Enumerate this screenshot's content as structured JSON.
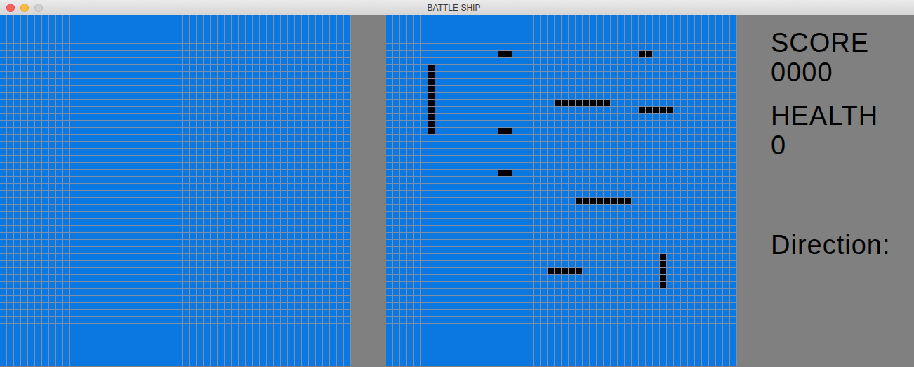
{
  "window": {
    "title": "BATTLE SHIP"
  },
  "player_board": {
    "rows": 50,
    "cols": 50,
    "ships": []
  },
  "enemy_board": {
    "rows": 50,
    "cols": 50,
    "ships": [
      {
        "row": 7,
        "col": 6,
        "length": 10,
        "orientation": "vertical"
      },
      {
        "row": 5,
        "col": 16,
        "length": 2,
        "orientation": "horizontal"
      },
      {
        "row": 5,
        "col": 36,
        "length": 2,
        "orientation": "horizontal"
      },
      {
        "row": 12,
        "col": 24,
        "length": 8,
        "orientation": "horizontal"
      },
      {
        "row": 13,
        "col": 36,
        "length": 5,
        "orientation": "horizontal"
      },
      {
        "row": 16,
        "col": 16,
        "length": 2,
        "orientation": "horizontal"
      },
      {
        "row": 22,
        "col": 16,
        "length": 2,
        "orientation": "horizontal"
      },
      {
        "row": 26,
        "col": 27,
        "length": 8,
        "orientation": "horizontal"
      },
      {
        "row": 36,
        "col": 23,
        "length": 5,
        "orientation": "horizontal"
      },
      {
        "row": 34,
        "col": 39,
        "length": 5,
        "orientation": "vertical"
      }
    ]
  },
  "panel": {
    "score_label": "SCORE",
    "score": "0000",
    "health_label": "HEALTH",
    "health": "0",
    "direction_label": "Direction:"
  }
}
